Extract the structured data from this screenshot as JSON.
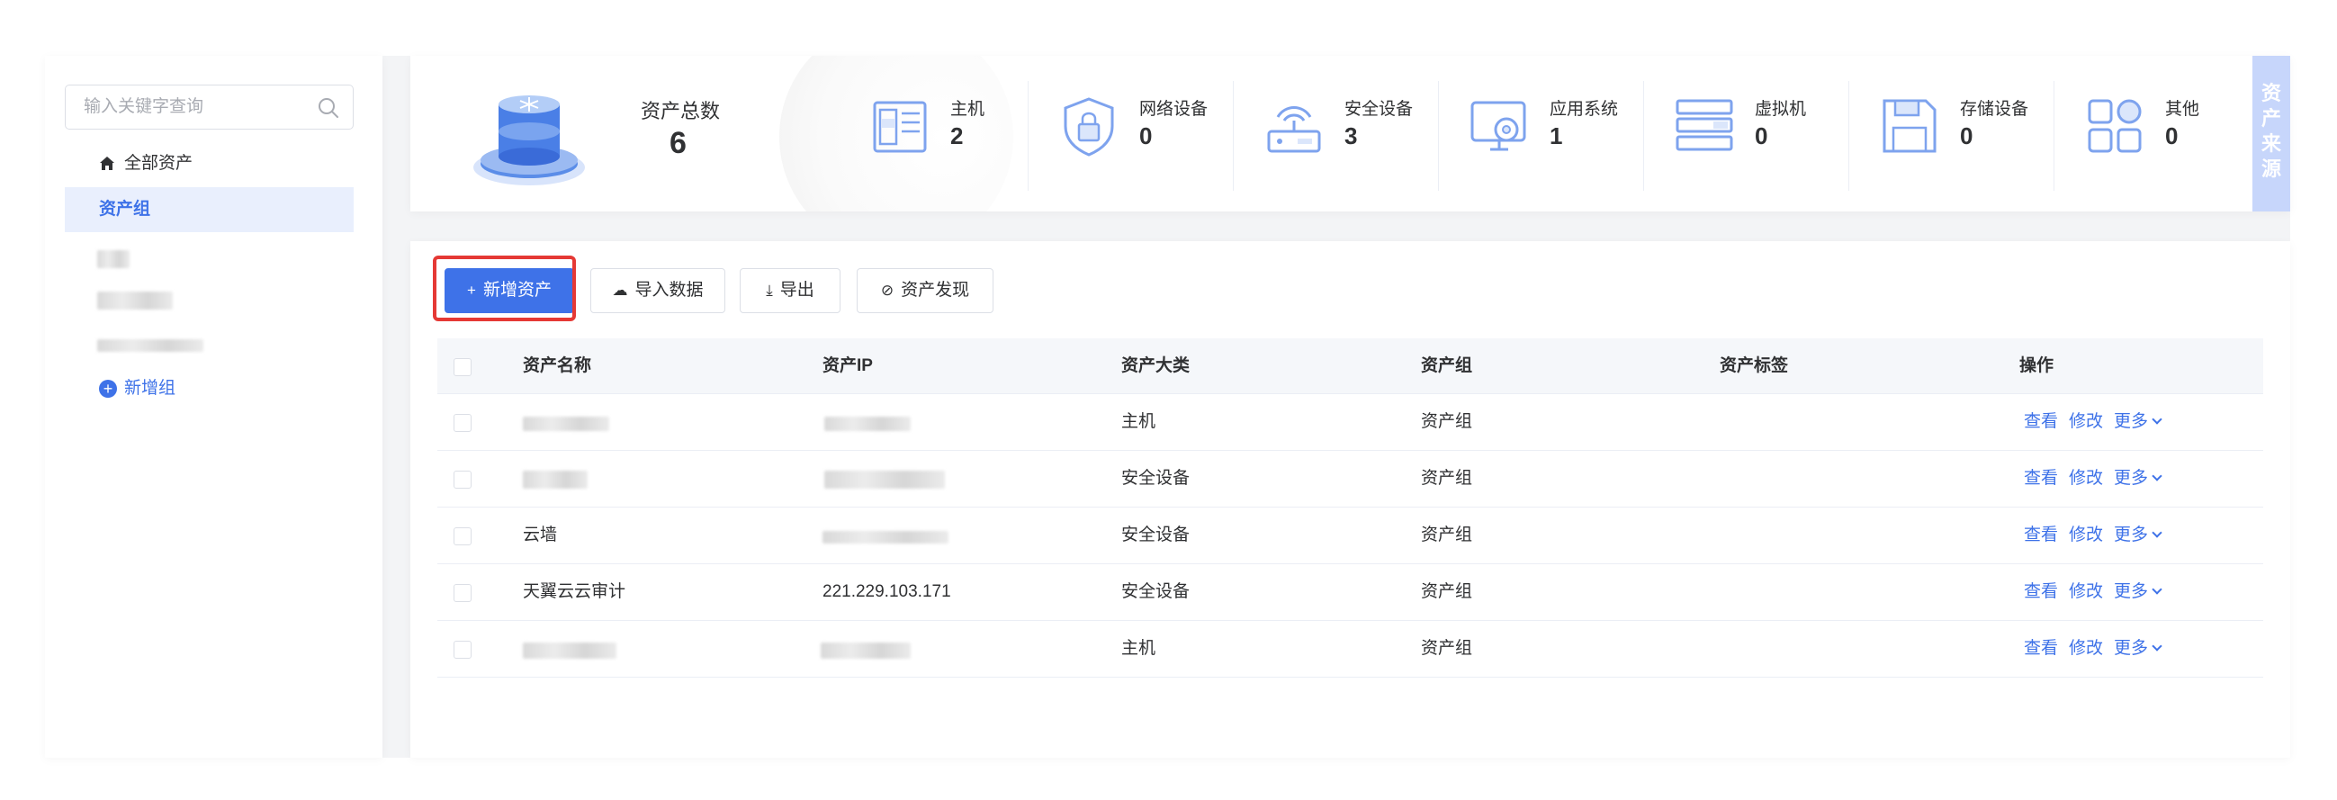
{
  "sidebar": {
    "search_placeholder": "输入关键字查询",
    "all_assets": "全部资产",
    "asset_group": "资产组",
    "add_group": "新增组"
  },
  "stats": {
    "total_label": "资产总数",
    "total_value": "6",
    "items": [
      {
        "label": "主机",
        "value": "2",
        "icon": "server-icon"
      },
      {
        "label": "网络设备",
        "value": "0",
        "icon": "shield-lock-icon"
      },
      {
        "label": "安全设备",
        "value": "3",
        "icon": "router-icon"
      },
      {
        "label": "应用系统",
        "value": "1",
        "icon": "monitor-gear-icon"
      },
      {
        "label": "虚拟机",
        "value": "0",
        "icon": "rack-icon"
      },
      {
        "label": "存储设备",
        "value": "0",
        "icon": "floppy-disk-icon"
      },
      {
        "label": "其他",
        "value": "0",
        "icon": "grid-icon"
      }
    ],
    "source_tab": "资产来源"
  },
  "toolbar": {
    "add_asset": "新增资产",
    "import_data": "导入数据",
    "export": "导出",
    "discover": "资产发现"
  },
  "table": {
    "columns": [
      "资产名称",
      "资产IP",
      "资产大类",
      "资产组",
      "资产标签",
      "操作"
    ],
    "rows": [
      {
        "name": "",
        "ip": "",
        "category": "主机",
        "group": "资产组",
        "tag": ""
      },
      {
        "name": "",
        "ip": "",
        "category": "安全设备",
        "group": "资产组",
        "tag": ""
      },
      {
        "name": "云墙",
        "ip": "",
        "category": "安全设备",
        "group": "资产组",
        "tag": ""
      },
      {
        "name": "天翼云云审计",
        "ip": "221.229.103.171",
        "category": "安全设备",
        "group": "资产组",
        "tag": ""
      },
      {
        "name": "",
        "ip": "",
        "category": "主机",
        "group": "资产组",
        "tag": ""
      }
    ],
    "actions": {
      "view": "查看",
      "edit": "修改",
      "more": "更多"
    }
  },
  "colors": {
    "accent": "#3e72e8",
    "highlight": "#e53935"
  }
}
